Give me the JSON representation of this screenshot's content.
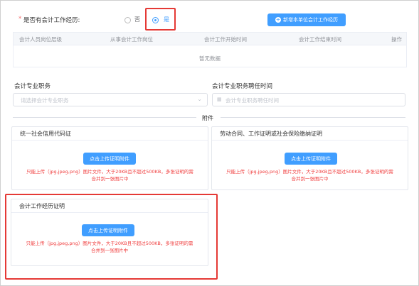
{
  "experience": {
    "required_mark": "*",
    "label": "是否有会计工作经历:",
    "option_no": "否",
    "option_yes": "是",
    "add_button": "新增本单位会计工作经历"
  },
  "table": {
    "columns": [
      "会计人员岗位层级",
      "从事会计工作岗位",
      "会计工作开始时间",
      "会计工作结束时间",
      "操作"
    ],
    "empty_text": "暂无数据"
  },
  "professional": {
    "title_label": "会计专业职务",
    "title_placeholder": "请选择会计专业职务",
    "appoint_label": "会计专业职务聘任时间",
    "appoint_placeholder": "会计专业职务聘任时间"
  },
  "attachments": {
    "divider_text": "附件",
    "upload_label": "点击上传证明附件",
    "hint_line1": "只能上传（jpg,jpeg,png）图片文件，大于20KB且不超过500KB，多张证明的需",
    "hint_line2": "合并到一张图片中",
    "cards": [
      {
        "title": "统一社会信用代码证"
      },
      {
        "title": "劳动合同、工作证明或社会保险缴纳证明"
      },
      {
        "title": "会计工作经历证明"
      }
    ]
  },
  "colors": {
    "primary": "#409eff",
    "highlight": "#e53935",
    "hint": "#f03c3c"
  }
}
